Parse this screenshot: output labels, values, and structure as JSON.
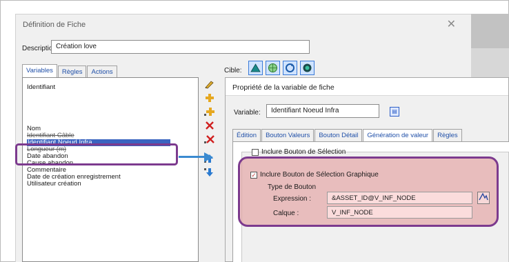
{
  "dialog": {
    "title": "Définition de Fiche",
    "close_glyph": "✕",
    "description_label": "Description:",
    "description_value": "Création love",
    "tabs": [
      {
        "label": "Variables",
        "active": true
      },
      {
        "label": "Règles",
        "active": false
      },
      {
        "label": "Actions",
        "active": false
      }
    ],
    "variables": {
      "first": "Identifiant",
      "items": [
        "Nom",
        "Identifiant Câble",
        "Identifiant Noeud Infra",
        "Longueur (m)",
        "Date abandon",
        "Cause abandon",
        "Commentaire",
        "Date de création enregistrement",
        "Utilisateur création"
      ],
      "selected_index": 2
    },
    "cible_label": "Cible:"
  },
  "prop_dialog": {
    "title": "Propriété de la variable de fiche",
    "variable_label": "Variable:",
    "variable_value": "Identifiant Noeud Infra",
    "tabs": [
      {
        "label": "Édition",
        "active": false
      },
      {
        "label": "Bouton Valeurs",
        "active": false
      },
      {
        "label": "Bouton Détail",
        "active": false
      },
      {
        "label": "Génération de valeur",
        "active": true
      },
      {
        "label": "Règles",
        "active": false
      }
    ],
    "include_selection": {
      "label": "Inclure Bouton de Sélection",
      "checked": false
    },
    "include_graphic": {
      "label": "Inclure Bouton de Sélection Graphique",
      "checked": true
    },
    "type_label": "Type de Bouton",
    "expression_label": "Expression :",
    "expression_value": "&ASSET_ID@V_INF_NODE",
    "calque_label": "Calque :",
    "calque_value": "V_INF_NODE"
  },
  "colors": {
    "highlight_border": "#7c3a8e",
    "highlight_fill": "#e29494",
    "arrow": "#3a8ad0",
    "selection": "#3a64c0"
  }
}
